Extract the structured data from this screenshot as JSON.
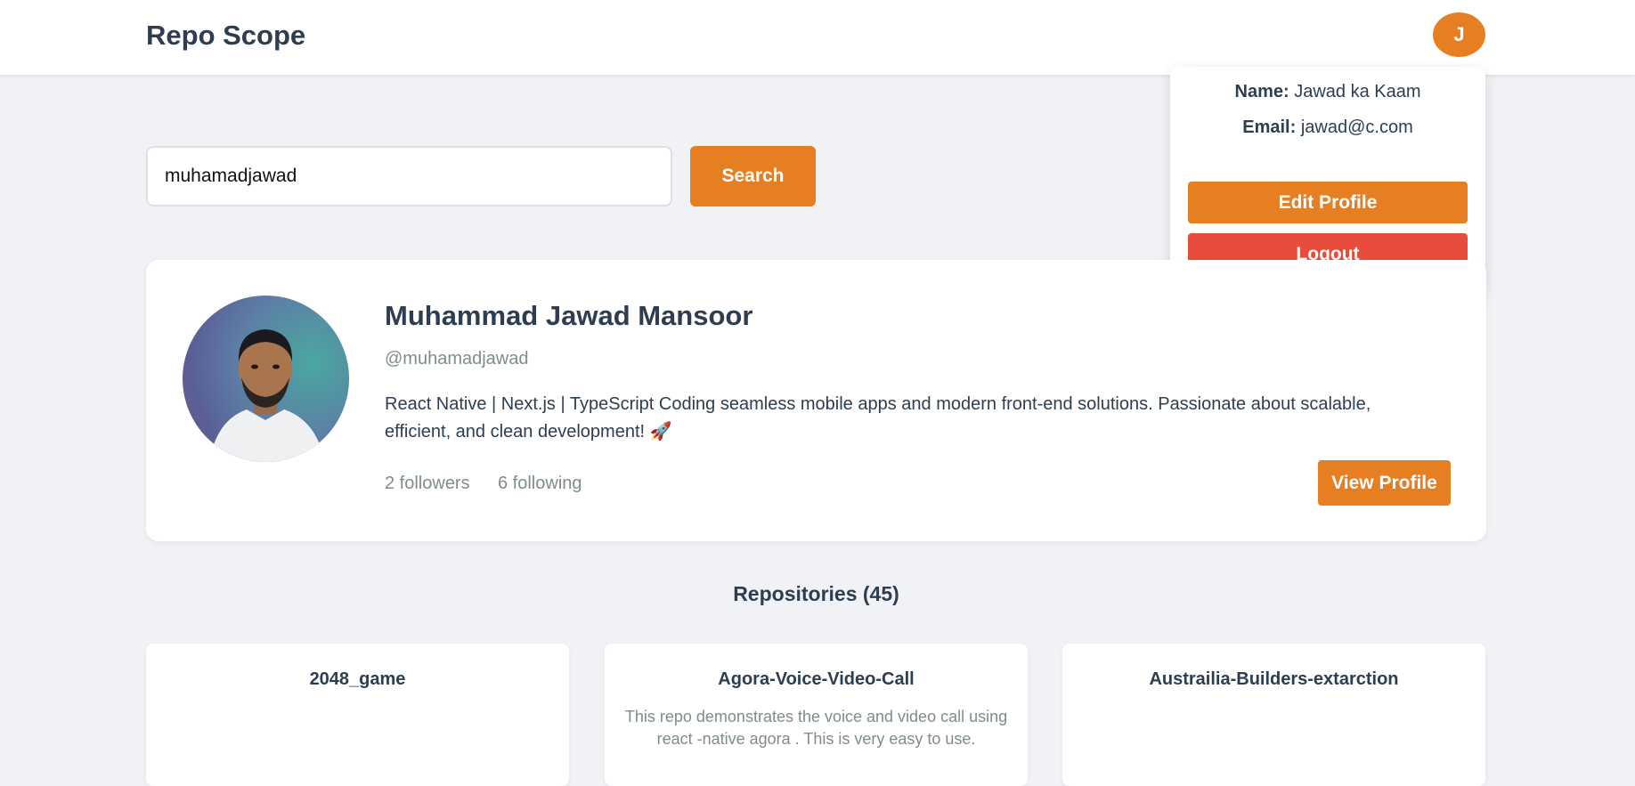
{
  "navbar": {
    "brand": "Repo Scope",
    "avatar_initial": "J"
  },
  "user_menu": {
    "name_label": "Name:",
    "name_value": "Jawad ka Kaam",
    "email_label": "Email:",
    "email_value": "jawad@c.com",
    "edit_profile_label": "Edit Profile",
    "logout_label": "Logout",
    "logout_color": "#e74c3c"
  },
  "search": {
    "value": "muhamadjawad",
    "button_label": "Search"
  },
  "profile": {
    "name": "Muhammad Jawad Mansoor",
    "handle": "@muhamadjawad",
    "bio": "React Native | Next.js | TypeScript Coding seamless mobile apps and modern front-end solutions. Passionate about scalable, efficient, and clean development! 🚀",
    "followers": "2 followers",
    "following": "6 following",
    "view_profile_label": "View Profile"
  },
  "repositories": {
    "heading": "Repositories (45)",
    "items": [
      {
        "name": "2048_game",
        "description": ""
      },
      {
        "name": "Agora-Voice-Video-Call",
        "description": "This repo demonstrates the voice and video call using react -native agora . This is very easy to use."
      },
      {
        "name": "Austrailia-Builders-extarction",
        "description": ""
      }
    ]
  },
  "theme": {
    "accent": "#e67e22",
    "text": "#2c3e50",
    "muted": "#7f8c8d",
    "background": "#f0f2f5"
  }
}
